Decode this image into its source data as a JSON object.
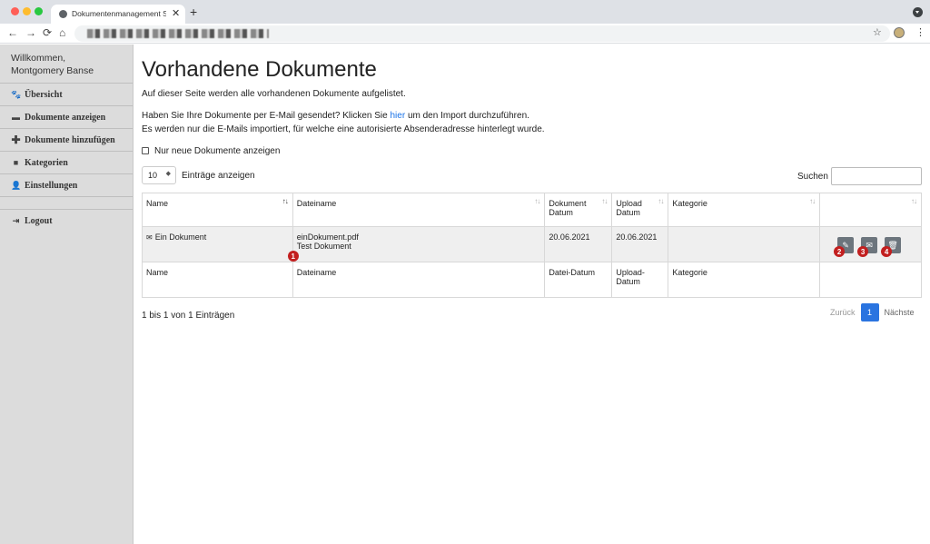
{
  "browser": {
    "tab_title": "Dokumentenmanagement Syst",
    "tab_close": "✕",
    "new_tab": "+",
    "nav_back": "←",
    "nav_forward": "→",
    "nav_reload": "⟳",
    "nav_home": "⌂",
    "star": "☆",
    "menu": "⋮"
  },
  "sidebar": {
    "welcome_line1": "Willkommen,",
    "welcome_line2": "Montgomery Banse",
    "items": [
      {
        "label": "Übersicht",
        "icon": "paw-icon"
      },
      {
        "label": "Dokumente anzeigen",
        "icon": "archive-icon"
      },
      {
        "label": "Dokumente hinzufügen",
        "icon": "plus-icon"
      },
      {
        "label": "Kategorien",
        "icon": "folder-icon"
      },
      {
        "label": "Einstellungen",
        "icon": "user-gear-icon"
      }
    ],
    "logout": {
      "label": "Logout",
      "icon": "logout-icon"
    }
  },
  "main": {
    "title": "Vorhandene Dokumente",
    "intro": "Auf dieser Seite werden alle vorhandenen Dokumente aufgelistet.",
    "email_text_before": "Haben Sie Ihre Dokumente per E-Mail gesendet? Klicken Sie ",
    "email_link": "hier",
    "email_text_after": " um den Import durchzuführen.",
    "email_note": "Es werden nur die E-Mails importiert, für welche eine autorisierte Absenderadresse hinterlegt wurde.",
    "checkbox_label": "Nur neue Dokumente anzeigen",
    "length_value": "10",
    "length_label": "Einträge anzeigen",
    "search_label": "Suchen",
    "search_value": "",
    "table": {
      "headers": [
        "Name",
        "Dateiname",
        "Dokument Datum",
        "Upload Datum",
        "Kategorie",
        ""
      ],
      "footers": [
        "Name",
        "Dateiname",
        "Datei-Datum",
        "Upload- Datum",
        "Kategorie",
        ""
      ],
      "rows": [
        {
          "name": "Ein Dokument",
          "filename": "einDokument.pdf",
          "description": "Test Dokument",
          "doc_date": "20.06.2021",
          "upload_date": "20.06.2021",
          "category": ""
        }
      ]
    },
    "markers": [
      "1",
      "2",
      "3",
      "4"
    ],
    "info": "1 bis 1 von 1 Einträgen",
    "pager": {
      "prev": "Zurück",
      "current": "1",
      "next": "Nächste"
    }
  }
}
